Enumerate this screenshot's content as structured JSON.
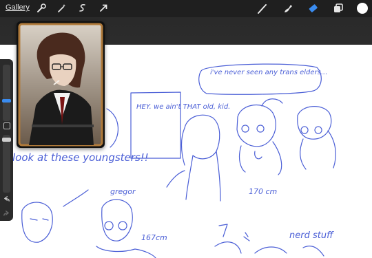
{
  "toolbar": {
    "gallery_label": "Gallery",
    "left_tools": [
      "wrench-icon",
      "magic-wand-icon",
      "selection-icon",
      "transform-arrow-icon"
    ],
    "right_tools": [
      "brush-icon",
      "smudge-icon",
      "eraser-icon",
      "layers-icon",
      "color-swatch"
    ],
    "active_tool": "eraser-icon",
    "color": "#ffffff"
  },
  "canvas": {
    "ink_color": "#4a5ed6",
    "notes": {
      "bubble_top": "i've never seen any trans elders...",
      "bubble_hey": "HEY. we ain't THAT old, kid.",
      "look": "look at these youngsters!!",
      "gregor": "gregor",
      "height_170": "170 cm",
      "height_167": "167cm",
      "nerd": "nerd stuff"
    }
  }
}
